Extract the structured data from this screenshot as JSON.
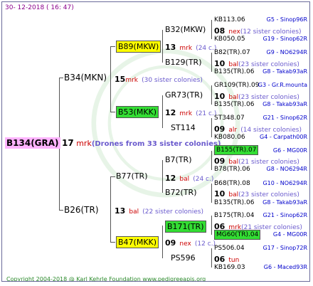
{
  "header": {
    "date": "30-  12-2018  (  16:  47)"
  },
  "root": {
    "name": "B134(GRA)"
  },
  "root_note": {
    "num": "17",
    "mark": "mrk",
    "text": "(Drones from 33 sister colonies)"
  },
  "gen1": [
    {
      "name": "B34(MKN)",
      "num": "15",
      "mark": "mrk",
      "sis": "(30 sister colonies)"
    },
    {
      "name": "B26(TR)",
      "num": "13",
      "mark": "bal",
      "sis": "(22 sister colonies)"
    }
  ],
  "gen2": [
    {
      "name": "B89(MKW)",
      "num": "13",
      "mark": "mrk",
      "sis": "(24 c.)"
    },
    {
      "name": "B53(MKK)",
      "num": "12",
      "mark": "mrk",
      "sis": "(21 c.)"
    },
    {
      "name": "B77(TR)",
      "num": "12",
      "mark": "bal",
      "sis": "(24 c.)"
    },
    {
      "name": "B47(MKK)",
      "num": "09",
      "mark": "nex",
      "sis": "(12 c.)"
    }
  ],
  "gen3": [
    {
      "name": "B32(MKW)",
      "num": "08",
      "mark": "nex",
      "sis": "(12 sister colonies)"
    },
    {
      "name": "B129(TR)",
      "num": "10",
      "mark": "bal",
      "sis": "(23 sister colonies)"
    },
    {
      "name": "GR73(TR)",
      "num": "10",
      "mark": "bal",
      "sis": "(23 sister colonies)"
    },
    {
      "name": "ST114",
      "num": "09",
      "mark": "alr",
      "sis": "(14 sister colonies)"
    },
    {
      "name": "B7(TR)",
      "num": "09",
      "mark": "bal",
      "sis": "(21 sister colonies)"
    },
    {
      "name": "B72(TR)",
      "num": "10",
      "mark": "bal",
      "sis": "(23 sister colonies)"
    },
    {
      "name": "B171(TR)",
      "num": "06",
      "mark": "mrk",
      "sis": "(21 sister colonies)"
    },
    {
      "name": "PS596",
      "num": "06",
      "mark": "tun",
      "sis": ""
    }
  ],
  "gen4": [
    {
      "name": "KB113.06",
      "id": "G5 - Sinop96R"
    },
    {
      "name": "KB050.05",
      "id": "G19 - Sinop62R"
    },
    {
      "name": "B82(TR).07",
      "id": "G9 - NO6294R"
    },
    {
      "name": "B135(TR).06",
      "id": "G8 - Takab93aR"
    },
    {
      "name": "GR109(TR).09",
      "id": "G3 - Gr.R.mounta"
    },
    {
      "name": "B135(TR).06",
      "id": "G8 - Takab93aR"
    },
    {
      "name": "ST348.07",
      "id": "G21 - Sinop62R"
    },
    {
      "name": "KB080.06",
      "id": "G4 - Carpath00R"
    },
    {
      "name": "B155(TR).07",
      "id": "G6 - MG00R"
    },
    {
      "name": "B78(TR).06",
      "id": "G8 - NO6294R"
    },
    {
      "name": "B68(TR).08",
      "id": "G10 - NO6294R"
    },
    {
      "name": "B135(TR).06",
      "id": "G8 - Takab93aR"
    },
    {
      "name": "B175(TR).04",
      "id": "G21 - Sinop62R"
    },
    {
      "name": "MG60(TR).04",
      "id": "G4 - MG00R"
    },
    {
      "name": "PS506.04",
      "id": "G17 - Sinop72R"
    },
    {
      "name": "KB169.03",
      "id": "G6 - Maced93R"
    }
  ],
  "footer": {
    "text": "Copyright 2004-2018 @ Karl Kehrle Foundation     www.pedigreeapis.org"
  }
}
